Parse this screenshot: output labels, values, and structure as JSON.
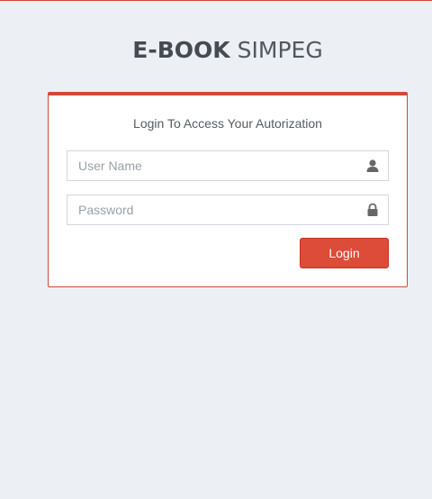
{
  "brand": {
    "bold": "E-BOOK",
    "light": "SIMPEG"
  },
  "login": {
    "title": "Login To Access Your Autorization",
    "username_placeholder": "User Name",
    "password_placeholder": "Password",
    "button_label": "Login"
  },
  "icons": {
    "username": "user-icon",
    "password": "lock-icon"
  },
  "colors": {
    "accent": "#dd4b39",
    "background": "#eceff4"
  }
}
